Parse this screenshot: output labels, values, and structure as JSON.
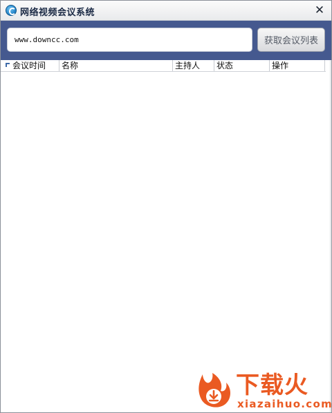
{
  "window": {
    "title": "网络视频会议系统",
    "close_symbol": "✕"
  },
  "toolbar": {
    "url_value": "www.downcc.com",
    "fetch_label": "获取会议列表"
  },
  "table": {
    "columns": [
      {
        "label": "会议时间"
      },
      {
        "label": "名称"
      },
      {
        "label": "主持人"
      },
      {
        "label": "状态"
      },
      {
        "label": "操作"
      }
    ],
    "rows": []
  },
  "watermark": {
    "brand": "下载火",
    "domain": "xiazaihuo.com"
  },
  "colors": {
    "toolbar_bg": "#45598f",
    "watermark": "#ea5a22"
  }
}
